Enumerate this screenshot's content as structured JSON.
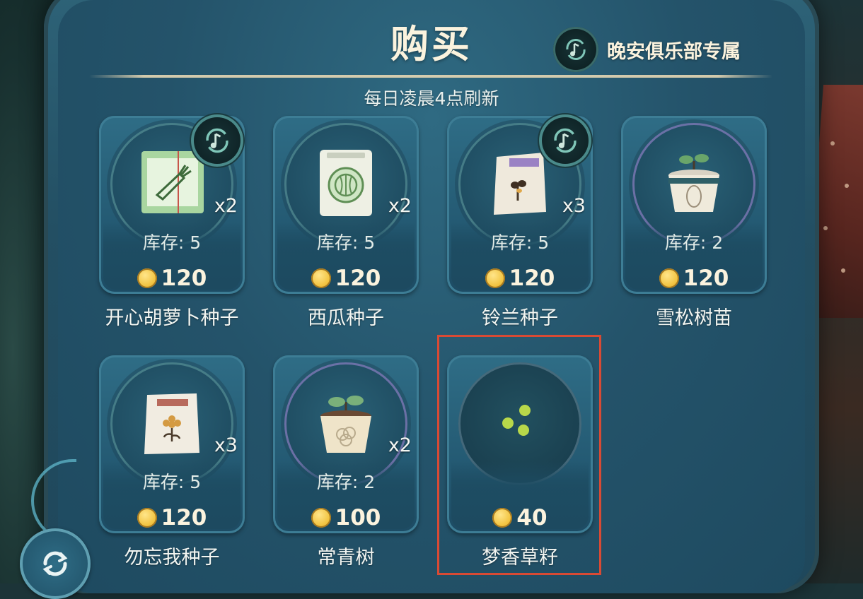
{
  "header": {
    "title": "购买",
    "club_label": "晚安俱乐部专属",
    "refresh_note": "每日凌晨4点刷新"
  },
  "items": [
    {
      "name": "开心胡萝卜种子",
      "stock_label": "库存: 5",
      "price": "120",
      "qty": "x2",
      "exclusive": true,
      "icon": "carrot-seed-packet-icon"
    },
    {
      "name": "西瓜种子",
      "stock_label": "库存: 5",
      "price": "120",
      "qty": "x2",
      "exclusive": false,
      "icon": "watermelon-seed-packet-icon"
    },
    {
      "name": "铃兰种子",
      "stock_label": "库存: 5",
      "price": "120",
      "qty": "x3",
      "exclusive": true,
      "icon": "lily-seed-bag-icon"
    },
    {
      "name": "雪松树苗",
      "stock_label": "库存: 2",
      "price": "120",
      "qty": "",
      "exclusive": false,
      "icon": "cedar-sapling-pot-icon"
    },
    {
      "name": "勿忘我种子",
      "stock_label": "库存: 5",
      "price": "120",
      "qty": "x3",
      "exclusive": false,
      "icon": "forget-me-not-seed-bag-icon"
    },
    {
      "name": "常青树",
      "stock_label": "库存: 2",
      "price": "100",
      "qty": "x2",
      "exclusive": false,
      "icon": "evergreen-pot-icon"
    },
    {
      "name": "梦香草籽",
      "stock_label": "",
      "price": "40",
      "qty": "",
      "exclusive": false,
      "icon": "dream-herb-seeds-icon"
    }
  ],
  "colors": {
    "panel": "#24536a",
    "text_light": "#fbf3de",
    "highlight": "#d94a34",
    "coin": "#f2c441"
  }
}
